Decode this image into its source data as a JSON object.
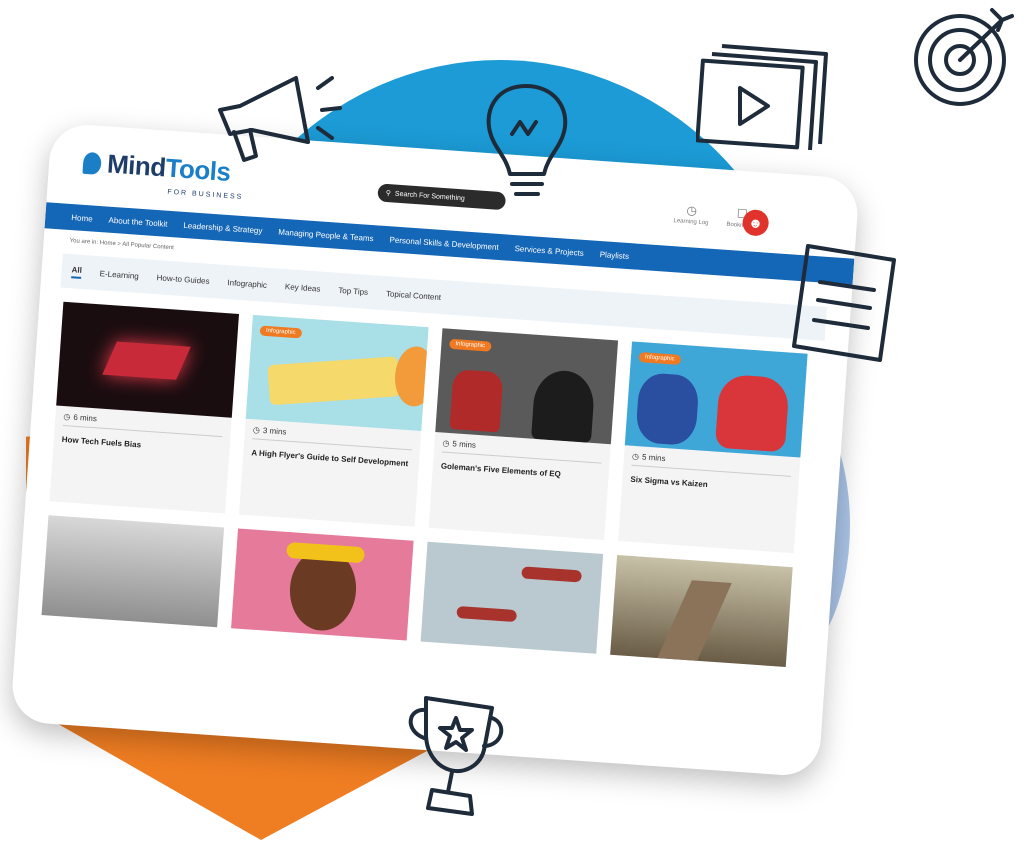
{
  "logo": {
    "name_a": "Mind",
    "name_b": "Tools",
    "sub": "FOR BUSINESS"
  },
  "search": {
    "placeholder": "Search For Something"
  },
  "header": {
    "icons": [
      {
        "icon": "clock-icon",
        "label": "Learning Log"
      },
      {
        "icon": "bookmark-icon",
        "label": "Bookmarks"
      }
    ]
  },
  "nav": {
    "items": [
      "Home",
      "About the Toolkit",
      "Leadership & Strategy",
      "Managing People & Teams",
      "Personal Skills & Development",
      "Services & Projects",
      "Playlists"
    ]
  },
  "breadcrumb": "You are in: Home > All Popular Content",
  "tabs": {
    "items": [
      "All",
      "E-Learning",
      "How-to Guides",
      "Infographic",
      "Key Ideas",
      "Top Tips",
      "Topical Content"
    ],
    "active": 0
  },
  "cards": [
    {
      "title": "How Tech Fuels Bias",
      "duration": "6 mins",
      "badge": "",
      "thumb_color": "#1a0d10"
    },
    {
      "title": "A High Flyer's Guide to Self Development",
      "duration": "3 mins",
      "badge": "Infographic",
      "thumb_color": "#a9dfe6"
    },
    {
      "title": "Goleman's Five Elements of EQ",
      "duration": "5 mins",
      "badge": "Infographic",
      "thumb_color": "#5a5a5a"
    },
    {
      "title": "Six Sigma vs Kaizen",
      "duration": "5 mins",
      "badge": "Infographic",
      "thumb_color": "#3fa7d8"
    }
  ],
  "row2": [
    {
      "thumb_color": "#9a9a9a"
    },
    {
      "thumb_color": "#e57a9a"
    },
    {
      "thumb_color": "#b9c9cf"
    },
    {
      "thumb_color": "#8a7d62"
    }
  ],
  "colors": {
    "nav": "#1466b6",
    "accent": "#ef7d22",
    "blob": "#1c9bd6"
  },
  "decor_icons": [
    "megaphone-icon",
    "lightbulb-icon",
    "video-stack-icon",
    "target-icon",
    "document-icon",
    "trophy-icon"
  ]
}
